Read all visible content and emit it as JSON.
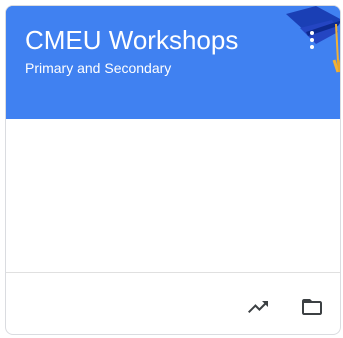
{
  "card": {
    "title": "CMEU Workshops",
    "subtitle": "Primary and Secondary",
    "header_color": "#4285f4",
    "menu_icon": "more-vert-icon",
    "theme_icon": "graduation-cap-icon"
  },
  "footer": {
    "actions": [
      {
        "icon": "trending-up-icon",
        "label": "Open progress"
      },
      {
        "icon": "folder-icon",
        "label": "Open folder"
      }
    ]
  }
}
